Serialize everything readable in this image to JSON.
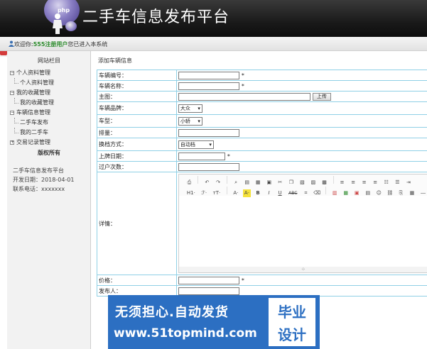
{
  "header": {
    "title": "二手车信息发布平台",
    "logo_text": "php"
  },
  "welcome": {
    "prefix": "欢迎你:",
    "username": "555注册用户",
    "suffix": "您已进入本系统"
  },
  "sidebar": {
    "heading": "网站栏目",
    "tree": [
      {
        "label": "个人资料管理",
        "level": 0,
        "expander": "−"
      },
      {
        "label": "个人资料管理",
        "level": 1
      },
      {
        "label": "我的收藏管理",
        "level": 0,
        "expander": "−"
      },
      {
        "label": "我的收藏管理",
        "level": 1
      },
      {
        "label": "车辆信息管理",
        "level": 0,
        "expander": "−"
      },
      {
        "label": "二手车发布",
        "level": 1
      },
      {
        "label": "我的二手车",
        "level": 1
      },
      {
        "label": "交易记录管理",
        "level": 0,
        "expander": "+"
      }
    ],
    "sub_heading": "版权所有",
    "info": {
      "line1": "二手车信息发布平台",
      "line2": "开发日期：2018-04-01",
      "line3": "联系电话：xxxxxxx"
    }
  },
  "main": {
    "breadcrumb": "添加车辆信息",
    "fields": {
      "car_no": {
        "label": "车辆编号：",
        "required": "*"
      },
      "car_name": {
        "label": "车辆名称：",
        "required": "*"
      },
      "main_image": {
        "label": "主图：",
        "button": "上传"
      },
      "brand": {
        "label": "车辆品牌：",
        "value": "大众"
      },
      "type": {
        "label": "车型：",
        "value": "小轿"
      },
      "displacement": {
        "label": "排量："
      },
      "gearbox": {
        "label": "换档方式：",
        "value": "自动档"
      },
      "reg_date": {
        "label": "上牌日期：",
        "required": "*"
      },
      "transfers": {
        "label": "过户次数："
      },
      "detail": {
        "label": "详情："
      },
      "price": {
        "label": "价格：",
        "required": "*"
      },
      "publisher": {
        "label": "发布人："
      }
    },
    "editor_toolbar": {
      "heading": "H1·",
      "font": "ℱ·",
      "size": "тT·",
      "font_color": "A·",
      "bg_color": "A·",
      "bold": "B",
      "italic": "I",
      "underline": "U",
      "strike": "ABC"
    },
    "editor_resize": "⊹"
  },
  "watermark": {
    "line1": "无须担心.自动发货",
    "line2": "www.51topmind.com",
    "badge1": "毕业",
    "badge2": "设计"
  },
  "colors": {
    "header_bg": "#1a1a1a",
    "table_border": "#8fd0e6",
    "username": "#2a8a2a",
    "banner": "#2c6fc2"
  }
}
